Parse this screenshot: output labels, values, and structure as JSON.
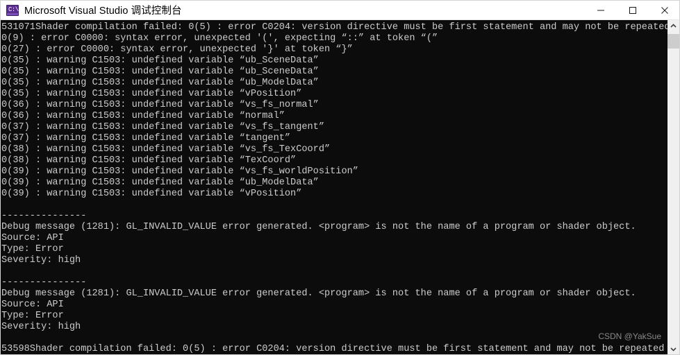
{
  "window": {
    "title": "Microsoft Visual Studio 调试控制台",
    "icon": "console-app-icon",
    "icon_glyph": "C:\\",
    "background_color": "#0c0c0c",
    "text_color": "#cccccc",
    "titlebar_color": "#ffffff"
  },
  "window_controls": {
    "minimize_label": "最小化",
    "maximize_label": "最大化",
    "close_label": "关闭",
    "minimize_icon": "minimize-icon",
    "maximize_icon": "maximize-icon",
    "close_icon": "close-icon"
  },
  "console": {
    "lines": [
      "531071Shader compilation failed: 0(5) : error C0204: version directive must be first statement and may not be repeated",
      "0(9) : error C0000: syntax error, unexpected '(', expecting “::” at token “(”",
      "0(27) : error C0000: syntax error, unexpected '}' at token “}”",
      "0(35) : warning C1503: undefined variable “ub_SceneData”",
      "0(35) : warning C1503: undefined variable “ub_SceneData”",
      "0(35) : warning C1503: undefined variable “ub_ModelData”",
      "0(35) : warning C1503: undefined variable “vPosition”",
      "0(36) : warning C1503: undefined variable “vs_fs_normal”",
      "0(36) : warning C1503: undefined variable “normal”",
      "0(37) : warning C1503: undefined variable “vs_fs_tangent”",
      "0(37) : warning C1503: undefined variable “tangent”",
      "0(38) : warning C1503: undefined variable “vs_fs_TexCoord”",
      "0(38) : warning C1503: undefined variable “TexCoord”",
      "0(39) : warning C1503: undefined variable “vs_fs_worldPosition”",
      "0(39) : warning C1503: undefined variable “ub_ModelData”",
      "0(39) : warning C1503: undefined variable “vPosition”",
      "",
      "---------------",
      "Debug message (1281): GL_INVALID_VALUE error generated. <program> is not the name of a program or shader object.",
      "Source: API",
      "Type: Error",
      "Severity: high",
      "",
      "---------------",
      "Debug message (1281): GL_INVALID_VALUE error generated. <program> is not the name of a program or shader object.",
      "Source: API",
      "Type: Error",
      "Severity: high",
      "",
      "53598Shader compilation failed: 0(5) : error C0204: version directive must be first statement and may not be repeated"
    ]
  },
  "watermark": {
    "text": "CSDN @YakSue"
  },
  "scrollbar": {
    "up_arrow_icon": "chevron-up-icon",
    "down_arrow_icon": "chevron-down-icon",
    "thumb_label": "scroll-thumb"
  }
}
